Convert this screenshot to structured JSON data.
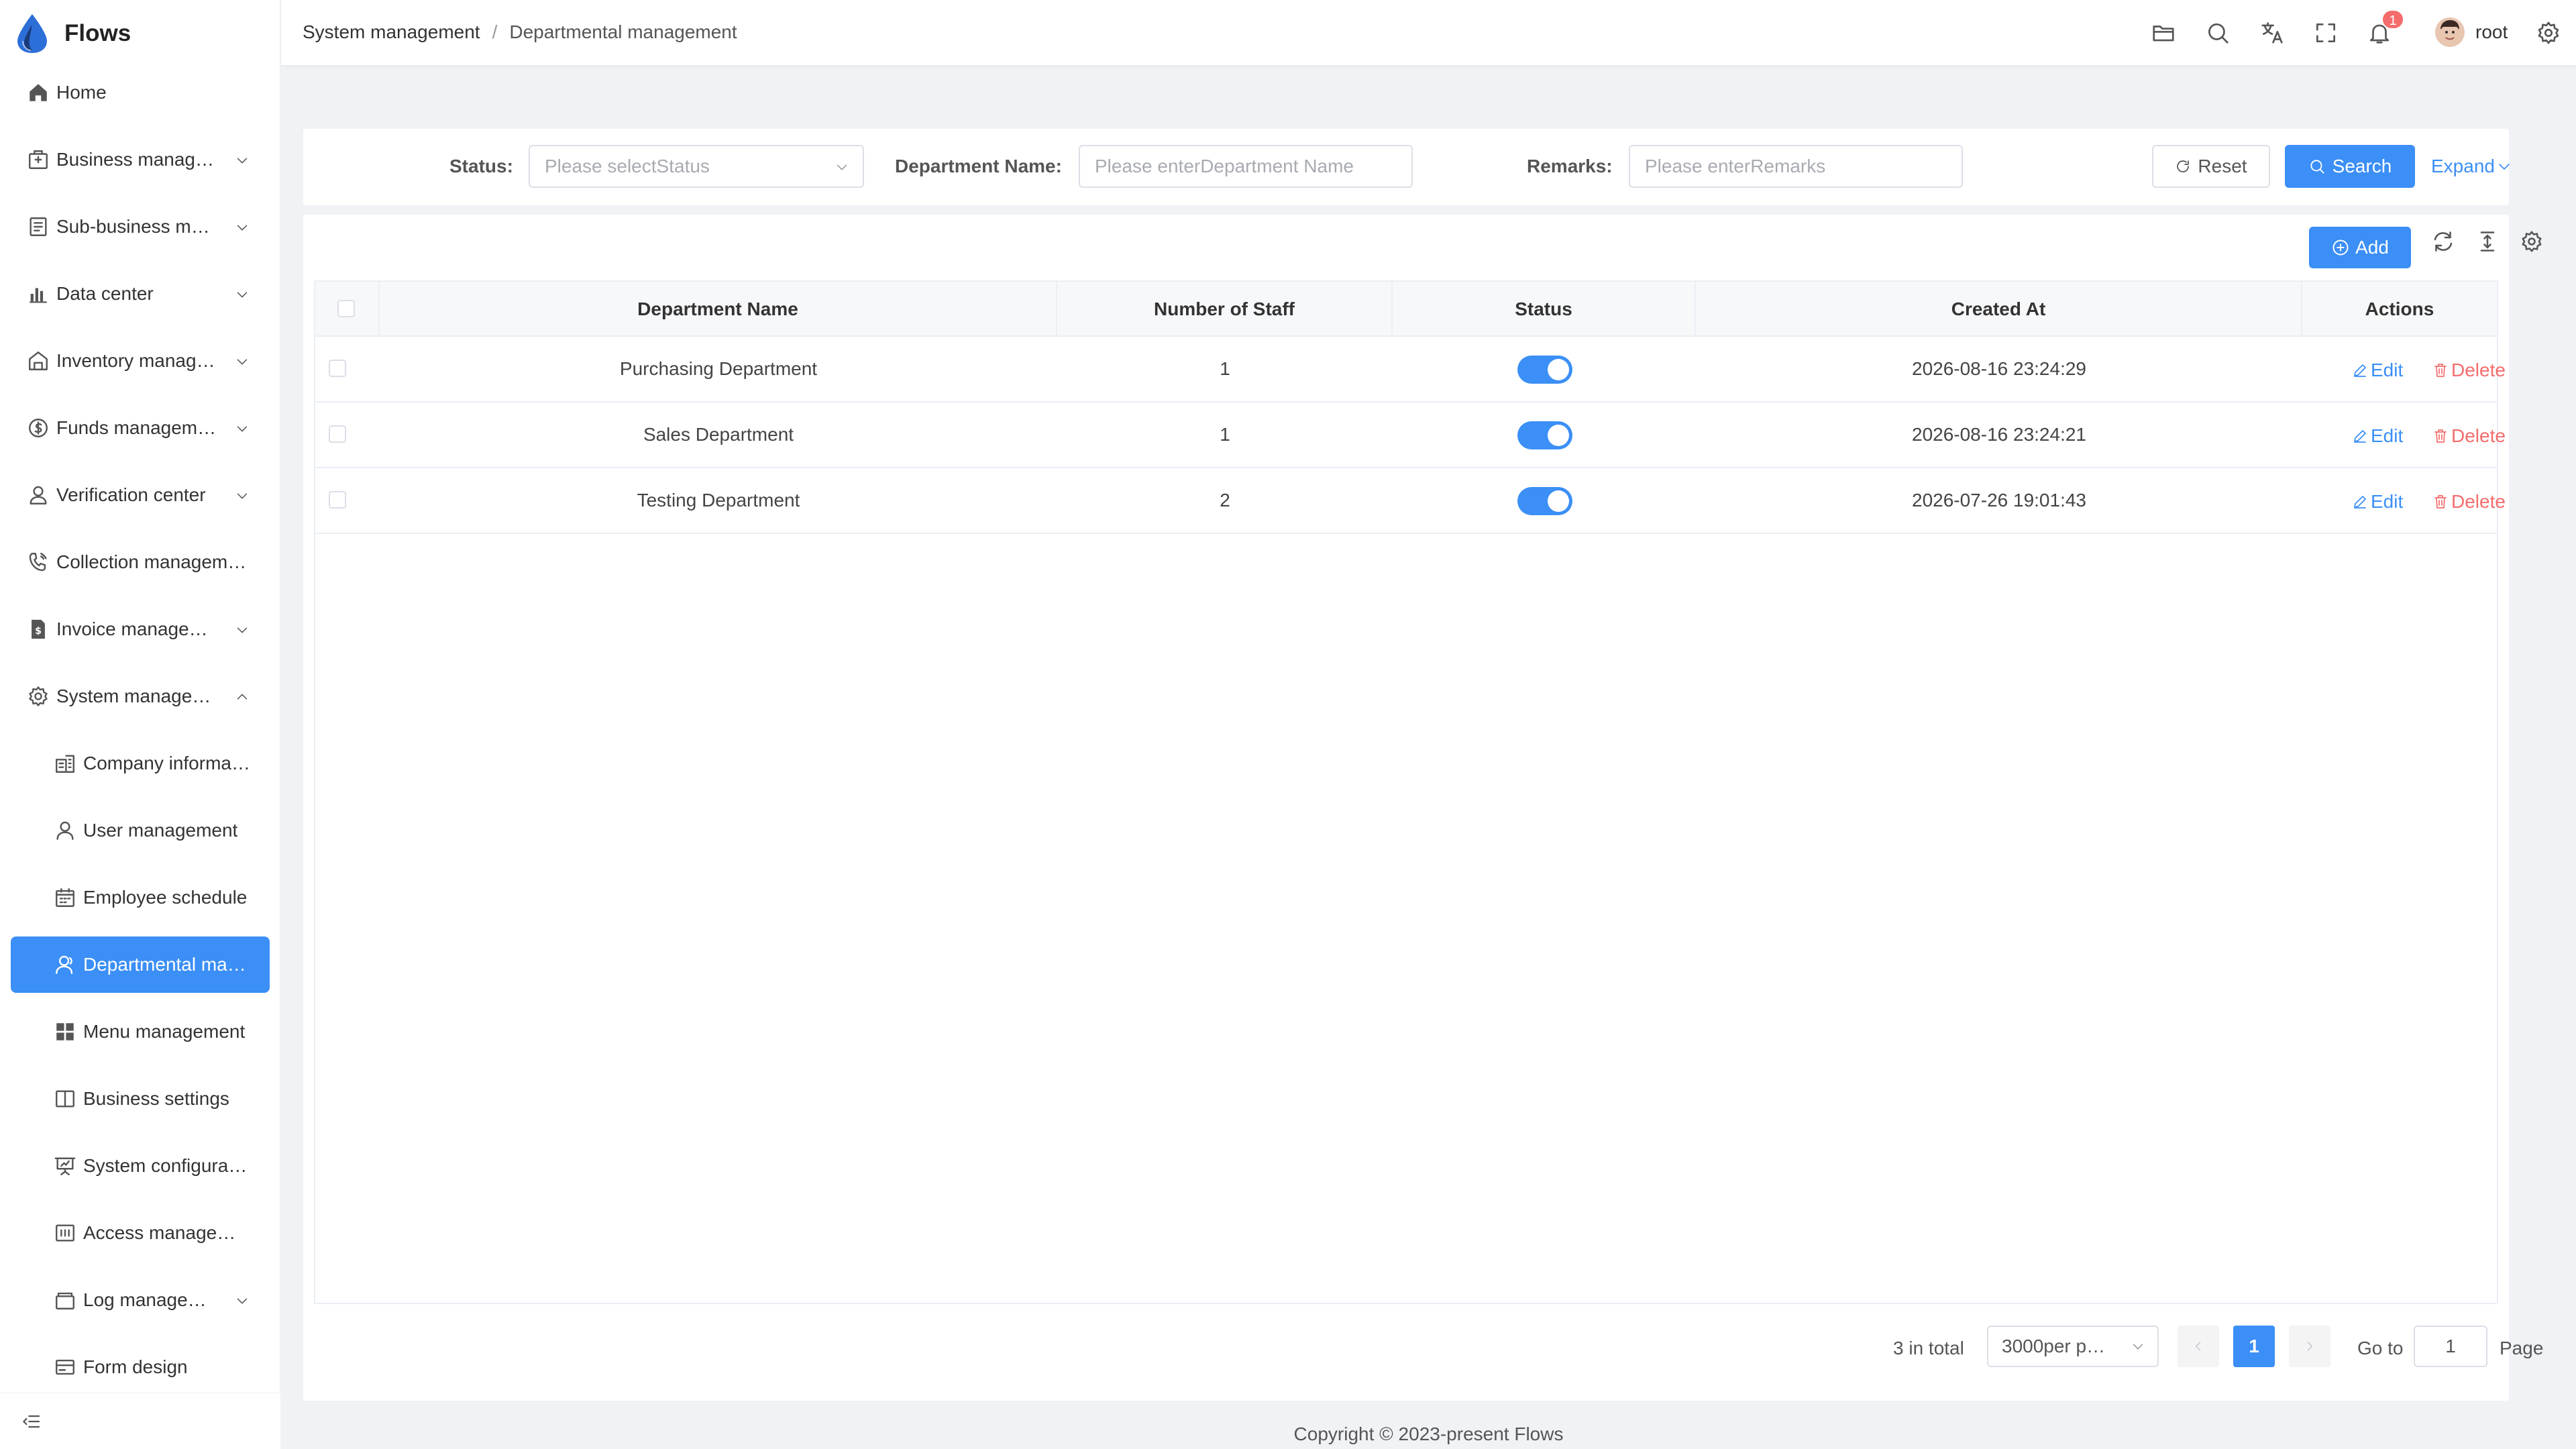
{
  "app": {
    "title": "Flows"
  },
  "sidebar": {
    "items": [
      {
        "label": "Home",
        "icon": "home-icon",
        "expandable": false
      },
      {
        "label": "Business manag…",
        "icon": "briefcase-icon",
        "expandable": true
      },
      {
        "label": "Sub-business m…",
        "icon": "document-list-icon",
        "expandable": true
      },
      {
        "label": "Data center",
        "icon": "bar-chart-icon",
        "expandable": true
      },
      {
        "label": "Inventory manag…",
        "icon": "warehouse-icon",
        "expandable": true
      },
      {
        "label": "Funds managem…",
        "icon": "coin-icon",
        "expandable": true
      },
      {
        "label": "Verification center",
        "icon": "user-check-icon",
        "expandable": true
      },
      {
        "label": "Collection managem…",
        "icon": "phone-icon",
        "expandable": false
      },
      {
        "label": "Invoice manage…",
        "icon": "invoice-icon",
        "expandable": true
      },
      {
        "label": "System manage…",
        "icon": "gear-icon",
        "expandable": true,
        "expanded": true
      }
    ],
    "sub_items": [
      {
        "label": "Company informa…",
        "icon": "building-icon"
      },
      {
        "label": "User management",
        "icon": "user-icon"
      },
      {
        "label": "Employee schedule",
        "icon": "calendar-icon"
      },
      {
        "label": "Departmental ma…",
        "icon": "users-icon",
        "active": true
      },
      {
        "label": "Menu management",
        "icon": "grid-icon"
      },
      {
        "label": "Business settings",
        "icon": "book-icon"
      },
      {
        "label": "System configurat…",
        "icon": "presentation-icon"
      },
      {
        "label": "Access managem…",
        "icon": "access-panel-icon"
      },
      {
        "label": "Log manage…",
        "icon": "folder-stack-icon",
        "expandable": true
      },
      {
        "label": "Form design",
        "icon": "card-icon"
      }
    ]
  },
  "header": {
    "breadcrumb": [
      "System management",
      "Departmental management"
    ],
    "notification_count": "1",
    "username": "root"
  },
  "search": {
    "status_label": "Status:",
    "status_placeholder": "Please selectStatus",
    "dept_label": "Department Name:",
    "dept_placeholder": "Please enterDepartment Name",
    "remarks_label": "Remarks:",
    "remarks_placeholder": "Please enterRemarks",
    "reset_label": "Reset",
    "search_label": "Search",
    "expand_label": "Expand"
  },
  "toolbar": {
    "add_label": "Add"
  },
  "table": {
    "columns": [
      "Department Name",
      "Number of Staff",
      "Status",
      "Created At",
      "Actions"
    ],
    "rows": [
      {
        "name": "Purchasing Department",
        "staff": "1",
        "status": true,
        "created": "2026-08-16 23:24:29"
      },
      {
        "name": "Sales Department",
        "staff": "1",
        "status": true,
        "created": "2026-08-16 23:24:21"
      },
      {
        "name": "Testing Department",
        "staff": "2",
        "status": true,
        "created": "2026-07-26 19:01:43"
      }
    ],
    "edit_label": "Edit",
    "delete_label": "Delete"
  },
  "pagination": {
    "total_text": "3 in total",
    "page_size": "3000per p…",
    "current_page": "1",
    "goto_label": "Go to",
    "goto_value": "1",
    "page_label": "Page"
  },
  "footer": {
    "copyright": "Copyright © 2023-present Flows"
  },
  "colors": {
    "primary": "#3b8ff6",
    "danger": "#f56c6c",
    "background": "#f0f2f5"
  }
}
